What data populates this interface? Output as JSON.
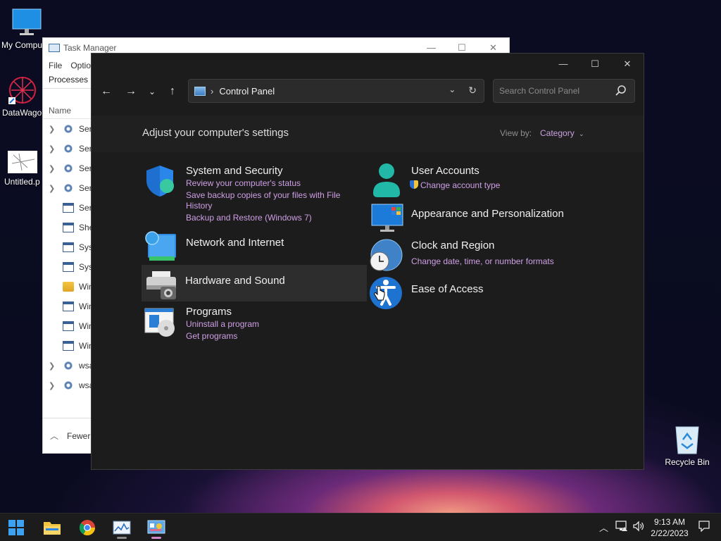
{
  "desktop": {
    "icons": [
      {
        "label": "My Compu"
      },
      {
        "label": "DataWagon"
      },
      {
        "label": "Untitled.p"
      },
      {
        "label": "Recycle Bin"
      }
    ]
  },
  "task_manager": {
    "title": "Task Manager",
    "menu": [
      "File",
      "Optio"
    ],
    "tab": "Processes",
    "column_header": "Name",
    "rows": [
      {
        "icon": "gear-icon",
        "label": "Serv",
        "expandable": true
      },
      {
        "icon": "gear-icon",
        "label": "Serv",
        "expandable": true
      },
      {
        "icon": "gear-icon",
        "label": "Serv",
        "expandable": true
      },
      {
        "icon": "gear-icon",
        "label": "Serv",
        "expandable": true
      },
      {
        "icon": "window-icon",
        "label": "Serv",
        "expandable": false
      },
      {
        "icon": "window-icon",
        "label": "She",
        "expandable": false
      },
      {
        "icon": "window-icon",
        "label": "Syst",
        "expandable": false
      },
      {
        "icon": "window-icon",
        "label": "Syst",
        "expandable": false
      },
      {
        "icon": "folder-icon",
        "label": "Win",
        "expandable": false
      },
      {
        "icon": "window-icon",
        "label": "Win",
        "expandable": false
      },
      {
        "icon": "window-icon",
        "label": "Win",
        "expandable": false
      },
      {
        "icon": "window-icon",
        "label": "Win",
        "expandable": false
      },
      {
        "icon": "gear-icon",
        "label": "wsa",
        "expandable": true
      },
      {
        "icon": "gear-icon",
        "label": "wsa",
        "expandable": true
      }
    ],
    "footer": "Fewer"
  },
  "control_panel": {
    "address": "Control Panel",
    "search_placeholder": "Search Control Panel",
    "header_title": "Adjust your computer's settings",
    "view_by_label": "View by:",
    "view_by_value": "Category",
    "categories": {
      "system": {
        "title": "System and Security",
        "links": [
          "Review your computer's status",
          "Save backup copies of your files with File",
          "History",
          "Backup and Restore (Windows 7)"
        ]
      },
      "network": {
        "title": "Network and Internet"
      },
      "hardware": {
        "title": "Hardware and Sound"
      },
      "programs": {
        "title": "Programs",
        "links": [
          "Uninstall a program",
          "Get programs"
        ]
      },
      "users": {
        "title": "User Accounts",
        "links": [
          "Change account type"
        ]
      },
      "appearance": {
        "title": "Appearance and Personalization"
      },
      "clock": {
        "title": "Clock and Region",
        "links": [
          "Change date, time, or number formats"
        ]
      },
      "ease": {
        "title": "Ease of Access"
      }
    }
  },
  "taskbar": {
    "time": "9:13 AM",
    "date": "2/22/2023"
  },
  "colors": {
    "accent_link": "#cf9fe6",
    "window_bg": "#1c1c1c"
  }
}
